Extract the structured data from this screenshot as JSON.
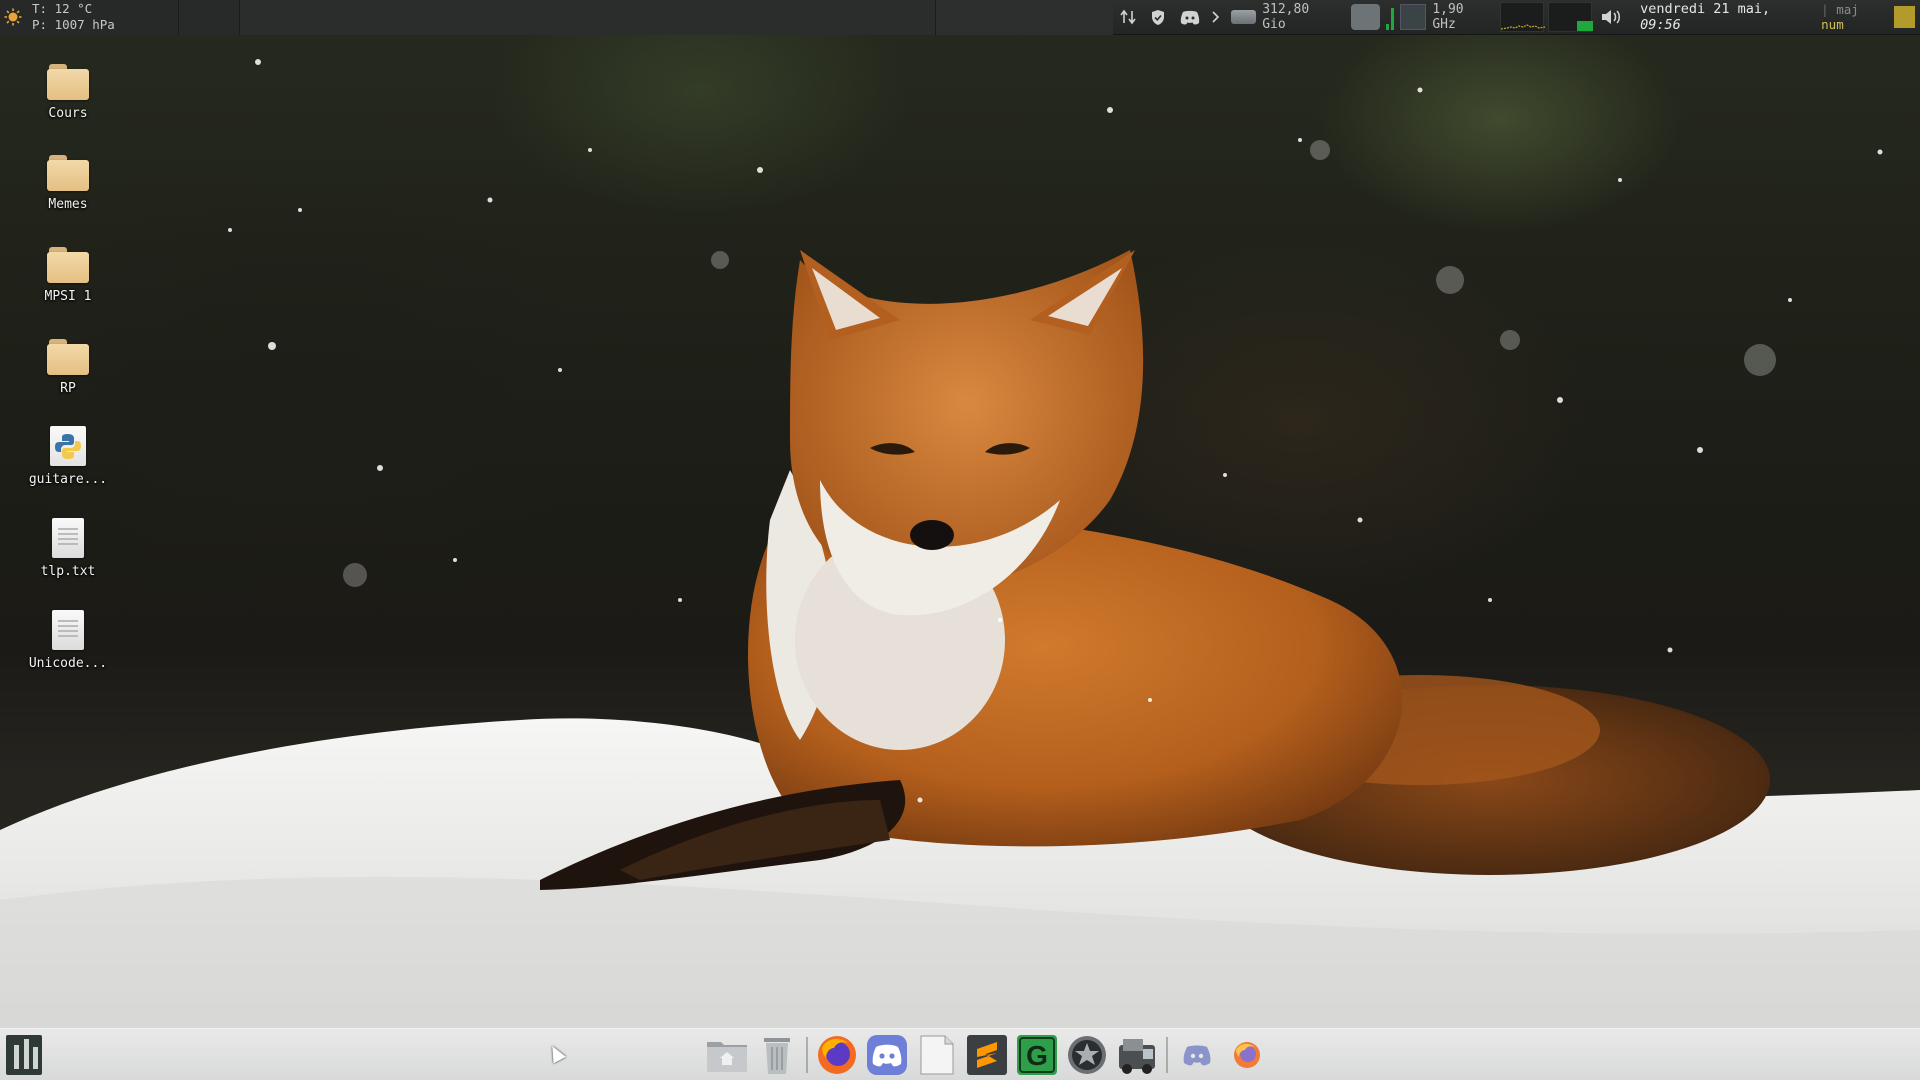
{
  "top_panel": {
    "weather": {
      "icon": "sun-icon",
      "temperature": "T: 12 °C",
      "pressure": "P: 1007 hPa"
    },
    "tray": {
      "network_icon": "network-arrows-icon",
      "vpn_icon": "shield-icon",
      "discord_icon": "discord-icon",
      "expand_icon": "chevron-right-icon"
    },
    "disk": {
      "icon": "hard-drive-icon",
      "value": "312,80 Gio"
    },
    "cpu": {
      "icon": "cpu-temp-icon",
      "frequency": "1,90 GHz"
    },
    "volume_icon": "speaker-icon",
    "clock": {
      "date": "vendredi 21 mai,",
      "time": "09:56"
    },
    "keyboard": {
      "caps": "maj",
      "num": "num",
      "separator": "|"
    }
  },
  "desktop_icons": [
    {
      "label": "Cours",
      "icon": "folder-icon"
    },
    {
      "label": "Memes",
      "icon": "folder-icon"
    },
    {
      "label": "MPSI 1",
      "icon": "folder-icon"
    },
    {
      "label": "RP",
      "icon": "folder-icon"
    },
    {
      "label": "guitare...",
      "icon": "python-file-icon"
    },
    {
      "label": "tlp.txt",
      "icon": "text-file-icon"
    },
    {
      "label": "Unicode...",
      "icon": "text-file-icon"
    }
  ],
  "dock": {
    "menu": "app-menu-icon",
    "items": [
      "home-folder-icon",
      "trash-icon",
      "firefox-icon",
      "discord-icon",
      "text-editor-icon",
      "sublime-text-icon",
      "g-app-icon",
      "steam-icon",
      "game-icon",
      "discord-running-icon",
      "firefox-running-icon"
    ]
  },
  "colors": {
    "panel_bg": "#252827",
    "accent_yellow": "#b29a2c",
    "graph_green": "#1fa83c",
    "folder": "#e9c68d"
  }
}
